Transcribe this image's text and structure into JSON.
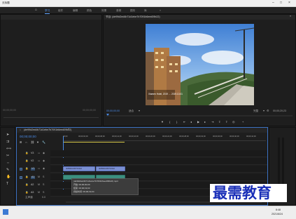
{
  "window": {
    "title": "无标题"
  },
  "workspaces": [
    "学习",
    "组件",
    "编辑",
    "颜色",
    "效果",
    "音频",
    "图形",
    "库"
  ],
  "source": {
    "timecode_left": "00;00;00;00",
    "timecode_right": "00;00;00;00"
  },
  "program": {
    "tab": "节目: (de99d2ed4b71d1ebe7b7091b6eed09b22)",
    "timecode_left": "00;00;00;00",
    "fit": "适合",
    "quality": "完整",
    "timecode_right": "00;00;20;23",
    "overlay_text": "Xiamen Hotel, 2019 … 2019.10.01"
  },
  "timeline": {
    "tab": "(de99d2ed4b71d1ebe7b7091b6eed09b22)",
    "timecode": "00;00;00;00",
    "ruler": [
      "00;00",
      "00;00;04;00",
      "00;00;08;00",
      "00;00;12;00",
      "00;00;16;00",
      "00;00;20;00",
      "00;00;24;00",
      "00;00;28;00",
      "00;00;32;00",
      "00;00;36;00",
      "00;00;40;00",
      "00;00;44;00",
      "00;00;48;00"
    ],
    "tracks": [
      "V3",
      "V2",
      "V1",
      "A1",
      "A2",
      "A3"
    ],
    "master_label": "主声道",
    "master_value": "0.0",
    "video_clips": [
      "de99d2ed4b71d1eb",
      "de99d2ed4b71d1eb"
    ],
    "audio_clips": [
      "",
      ""
    ]
  },
  "tooltip": {
    "line1": "(de99d2ed4b71d1ebe7b7091b6eed09b22).mp4",
    "line2": "开始: 00;00;00;00",
    "line3": "结束: 00;00;19;03",
    "line4": "持续时间: 00;00;19;04"
  },
  "watermark": {
    "text": "最需教育"
  },
  "taskbar": {
    "time": "8:48",
    "date": "2021/6/24"
  },
  "colors": {
    "accent": "#4a8be8",
    "video_clip": "#7a8fd2",
    "audio_clip": "#3c8f80",
    "background": "#1d1d1d"
  }
}
